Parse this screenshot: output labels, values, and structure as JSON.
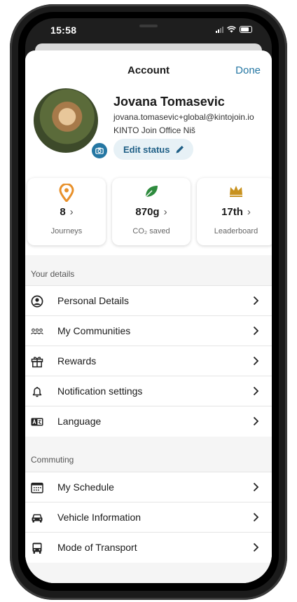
{
  "status_bar": {
    "time": "15:58"
  },
  "header": {
    "title": "Account",
    "done_label": "Done"
  },
  "profile": {
    "name": "Jovana Tomasevic",
    "email": "jovana.tomasevic+global@kintojoin.io",
    "office": "KINTO Join Office Niš",
    "edit_status_label": "Edit status"
  },
  "stats": [
    {
      "value": "8",
      "label": "Journeys",
      "icon": "location-pin-icon",
      "color": "#e8902a"
    },
    {
      "value": "870g",
      "label": "CO₂ saved",
      "icon": "leaf-icon",
      "color": "#2e8b3e"
    },
    {
      "value": "17th",
      "label": "Leaderboard",
      "icon": "crown-icon",
      "color": "#c8921f"
    }
  ],
  "your_details": {
    "title": "Your details",
    "items": [
      {
        "label": "Personal Details",
        "icon": "user-circle-icon"
      },
      {
        "label": "My Communities",
        "icon": "community-icon"
      },
      {
        "label": "Rewards",
        "icon": "gift-icon"
      },
      {
        "label": "Notification settings",
        "icon": "bell-icon"
      },
      {
        "label": "Language",
        "icon": "language-icon"
      }
    ]
  },
  "commuting": {
    "title": "Commuting",
    "items": [
      {
        "label": "My Schedule",
        "icon": "calendar-icon"
      },
      {
        "label": "Vehicle Information",
        "icon": "car-icon"
      },
      {
        "label": "Mode of Transport",
        "icon": "bus-icon"
      }
    ]
  },
  "colors": {
    "accent": "#2577a3",
    "edit_button_bg": "#e7f1f6"
  }
}
